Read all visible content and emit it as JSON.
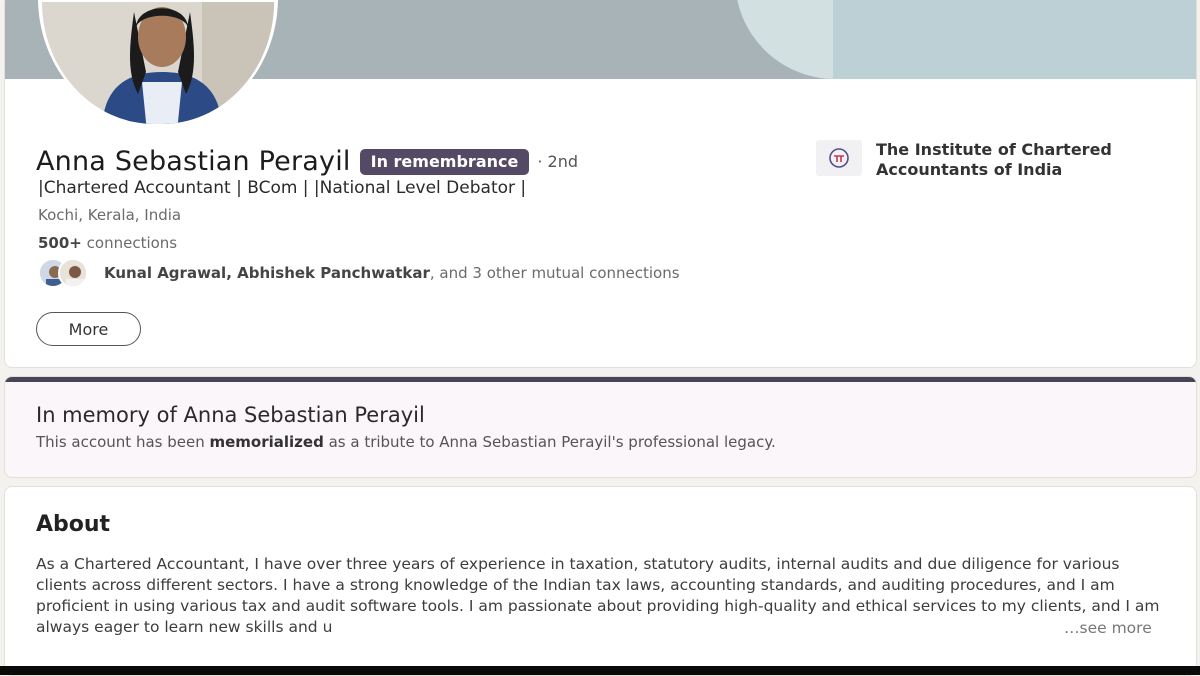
{
  "profile": {
    "name": "Anna Sebastian Perayil",
    "badge": "In remembrance",
    "degree": "· 2nd",
    "headline": "|Chartered Accountant | BCom | |National Level Debator |",
    "location": "Kochi, Kerala, India",
    "connections_count": "500+",
    "connections_label": " connections",
    "mutual_names": "Kunal Agrawal, Abhishek Panchwatkar",
    "mutual_suffix": ", and 3 other mutual connections",
    "more_label": "More",
    "organization": "The Institute of Chartered Accountants of India"
  },
  "memorial": {
    "title": "In memory of Anna Sebastian Perayil",
    "desc_before": "This account has been ",
    "desc_bold": "memorialized",
    "desc_after": " as a tribute to Anna Sebastian Perayil's professional legacy."
  },
  "about": {
    "title": "About",
    "text": "As a Chartered Accountant, I have over three years of experience in taxation, statutory audits, internal audits and due diligence for various clients across different sectors. I have a strong knowledge of the Indian tax laws, accounting standards, and auditing procedures, and I am proficient in using various tax and audit software tools. I am passionate about providing high-quality and ethical services to my clients, and I am always eager to learn new skills and u",
    "see_more": "…see more"
  },
  "colors": {
    "badge_bg": "#544a65",
    "banner": "#a7b3b6",
    "memorial_bar": "#4a4458"
  }
}
